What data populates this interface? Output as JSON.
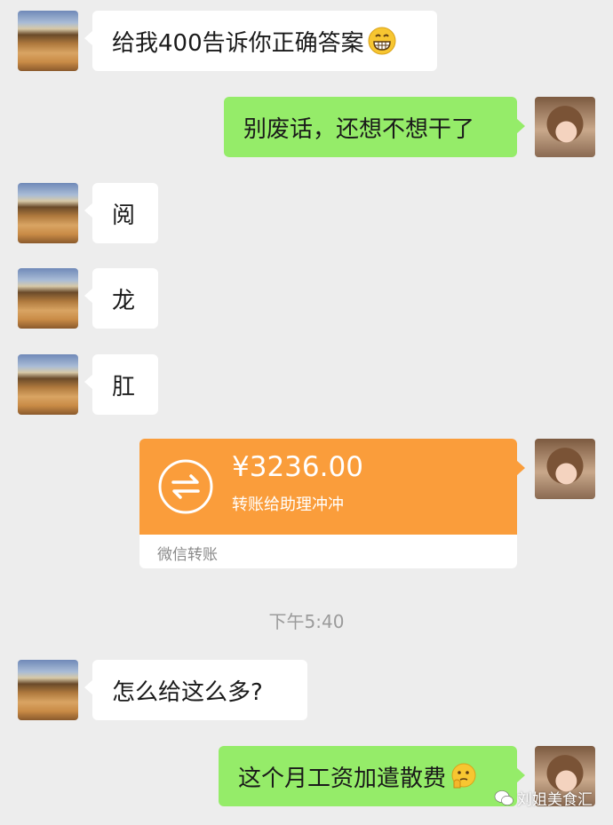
{
  "messages": [
    {
      "text": "给我400告诉你正确答案",
      "emoji": "grinning-emoji"
    },
    {
      "text": "别废话，还想不想干了"
    },
    {
      "text": "阅"
    },
    {
      "text": "龙"
    },
    {
      "text": "肛"
    },
    {
      "text": "怎么给这么多?"
    },
    {
      "text": "这个月工资加遣散费",
      "emoji": "thinking-emoji"
    }
  ],
  "transfer": {
    "amount": "¥3236.00",
    "note": "转账给助理冲冲",
    "label": "微信转账",
    "icon": "transfer-arrows-icon",
    "color": "#fa9d3b"
  },
  "timestamp": "下午5:40",
  "watermark": "刘姐美食汇",
  "colors": {
    "background": "#ededed",
    "sent_bubble": "#95ec69",
    "received_bubble": "#ffffff"
  }
}
